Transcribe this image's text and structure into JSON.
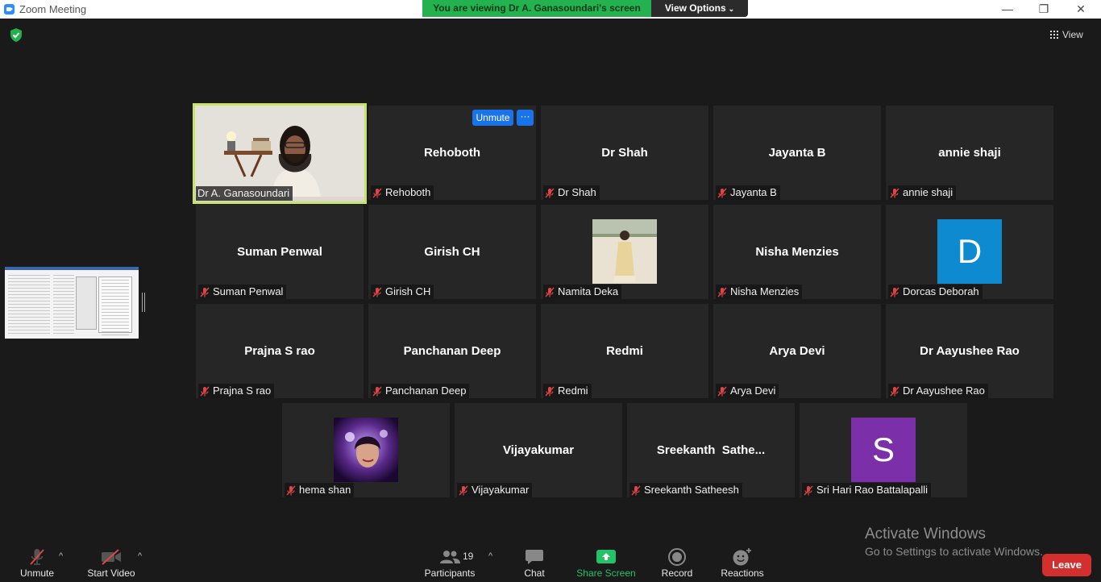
{
  "window": {
    "title": "Zoom Meeting",
    "controls": [
      "—",
      "❐",
      "✕"
    ]
  },
  "banner": {
    "viewing_text": "You are viewing Dr A. Ganasoundari's screen",
    "view_options_label": "View Options"
  },
  "top_right": {
    "view_label": "View"
  },
  "overlay_buttons": {
    "unmute": "Unmute",
    "more": "···"
  },
  "participants": [
    {
      "display": "Dr A. Ganasoundari",
      "label": "Dr A. Ganasoundari",
      "type": "video",
      "active": true,
      "muted": false
    },
    {
      "display": "Rehoboth",
      "label": "Rehoboth",
      "type": "name",
      "muted": true
    },
    {
      "display": "Dr Shah",
      "label": "Dr Shah",
      "type": "name",
      "muted": true
    },
    {
      "display": "Jayanta B",
      "label": "Jayanta B",
      "type": "name",
      "muted": true
    },
    {
      "display": "annie shaji",
      "label": "annie shaji",
      "type": "name",
      "muted": true
    },
    {
      "display": "Suman Penwal",
      "label": "Suman Penwal",
      "type": "name",
      "muted": true
    },
    {
      "display": "Girish CH",
      "label": "Girish CH",
      "type": "name",
      "muted": true
    },
    {
      "display": "",
      "label": "Namita Deka",
      "type": "photo",
      "muted": true
    },
    {
      "display": "Nisha Menzies",
      "label": "Nisha Menzies",
      "type": "name",
      "muted": true
    },
    {
      "display": "D",
      "label": "Dorcas Deborah",
      "type": "letter",
      "avatar_color": "#0e8ad1",
      "muted": true
    },
    {
      "display": "Prajna S rao",
      "label": "Prajna S rao",
      "type": "name",
      "muted": true
    },
    {
      "display": "Panchanan Deep",
      "label": "Panchanan Deep",
      "type": "name",
      "muted": true
    },
    {
      "display": "Redmi",
      "label": "Redmi",
      "type": "name",
      "muted": true
    },
    {
      "display": "Arya Devi",
      "label": "Arya Devi",
      "type": "name",
      "muted": true
    },
    {
      "display": "Dr Aayushee Rao",
      "label": "Dr Aayushee Rao",
      "type": "name",
      "muted": true
    },
    {
      "display": "",
      "label": "hema shan",
      "type": "photo",
      "muted": true
    },
    {
      "display": "Vijayakumar",
      "label": "Vijayakumar",
      "type": "name",
      "muted": true
    },
    {
      "display": "Sreekanth  Sathe...",
      "label": "Sreekanth Satheesh",
      "type": "name",
      "muted": true
    },
    {
      "display": "S",
      "label": "Sri Hari Rao Battalapalli",
      "type": "letter",
      "avatar_color": "#7b2fa8",
      "muted": true
    }
  ],
  "toolbar": {
    "unmute": "Unmute",
    "start_video": "Start Video",
    "participants": "Participants",
    "participants_count": "19",
    "chat": "Chat",
    "share_screen": "Share Screen",
    "record": "Record",
    "reactions": "Reactions",
    "leave": "Leave"
  },
  "watermark": {
    "line1": "Activate Windows",
    "line2": "Go to Settings to activate Windows."
  },
  "colors": {
    "background": "#1a1a1a",
    "tile": "#262626",
    "active_border": "#c7e36a",
    "banner_green": "#24b14f",
    "leave_red": "#d32f2f",
    "share_green": "#25c166",
    "unmute_blue": "#1a73e8"
  }
}
